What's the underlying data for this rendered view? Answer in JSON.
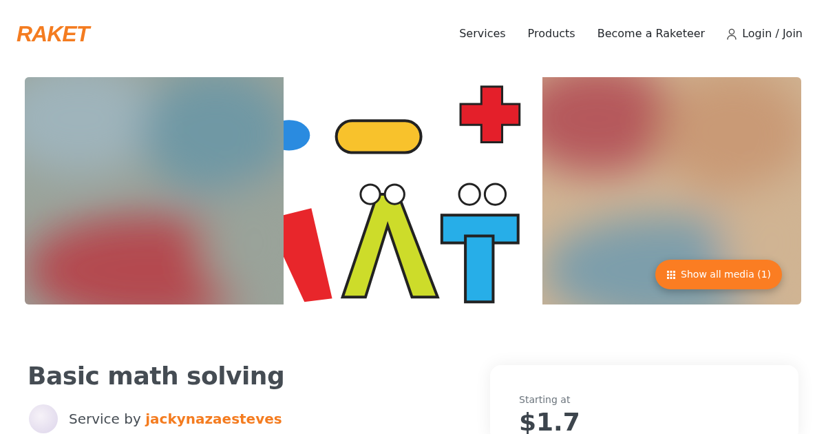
{
  "brand": "RAKET",
  "nav": [
    {
      "label": "Services"
    },
    {
      "label": "Products"
    },
    {
      "label": "Become a Raketeer"
    },
    {
      "label": "Login / Join",
      "kind": "account"
    }
  ],
  "gallery": {
    "panels": [
      {
        "kind": "blurred"
      },
      {
        "kind": "picture"
      },
      {
        "kind": "blurred"
      }
    ],
    "show_all": "Show all media (1)"
  },
  "title": "Basic math solving",
  "seller": {
    "prefix": "Service by",
    "name": "jackynazaesteves"
  },
  "price_card": {
    "label": "Starting at",
    "price": "$1.7"
  }
}
